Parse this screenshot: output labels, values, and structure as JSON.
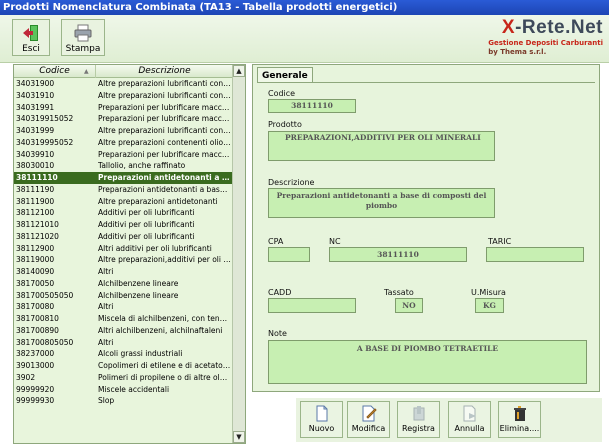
{
  "window": {
    "title": "Prodotti Nomenclatura Combinata (TA13 - Tabella prodotti energetici)"
  },
  "toolbar": {
    "exit_label": "Esci",
    "print_label": "Stampa"
  },
  "brand": {
    "name_x": "X",
    "name_rest": "-Rete.Net",
    "subtitle1": "Gestione Depositi Carburanti",
    "subtitle2": "by Thema s.r.l."
  },
  "list": {
    "columns": {
      "code": "Codice",
      "description": "Descrizione"
    },
    "rows": [
      {
        "code": "34031900",
        "desc": "Altre preparazioni lubrificanti conte..."
      },
      {
        "code": "34031910",
        "desc": "Altre preparazioni lubrificanti conte..."
      },
      {
        "code": "34031991",
        "desc": "Preparazioni per lubrificare macchi..."
      },
      {
        "code": "340319915052",
        "desc": "Preparazioni per lubrificare macchi..."
      },
      {
        "code": "34031999",
        "desc": "Altre preparazioni lubrificanti conte..."
      },
      {
        "code": "340319995052",
        "desc": "Altre preparazioni contenenti olio ri..."
      },
      {
        "code": "34039910",
        "desc": "Preparazioni per lubrificare macchi..."
      },
      {
        "code": "38030010",
        "desc": "Tallolio, anche raffinato"
      },
      {
        "code": "38111110",
        "desc": "Preparazioni antidetonanti a b...",
        "selected": true
      },
      {
        "code": "38111190",
        "desc": "Preparazioni antidetonanti a base..."
      },
      {
        "code": "38111900",
        "desc": "Altre preparazioni antidetonanti"
      },
      {
        "code": "38112100",
        "desc": "Additivi per oli lubrificanti"
      },
      {
        "code": "381121010",
        "desc": "Additivi per oli lubrificanti"
      },
      {
        "code": "381121020",
        "desc": "Additivi per oli lubrificanti"
      },
      {
        "code": "38112900",
        "desc": "Altri additivi per oli lubrificanti"
      },
      {
        "code": "38119000",
        "desc": "Altre preparazioni,additivi per oli m..."
      },
      {
        "code": "38140090",
        "desc": "Altri"
      },
      {
        "code": "38170050",
        "desc": "Alchilbenzene lineare"
      },
      {
        "code": "381700505050",
        "desc": "Alchilbenzene lineare"
      },
      {
        "code": "38170080",
        "desc": "Altri"
      },
      {
        "code": "381700810",
        "desc": "Miscela di alchilbenzeni, con tenore..."
      },
      {
        "code": "381700890",
        "desc": "Altri alchilbenzeni, alchilnaftaleni"
      },
      {
        "code": "381700805050",
        "desc": "Altri"
      },
      {
        "code": "38237000",
        "desc": "Alcoli grassi industriali"
      },
      {
        "code": "39013000",
        "desc": "Copolimeri di etilene e di acetato d..."
      },
      {
        "code": "3902",
        "desc": "Polimeri di propilene o di altre olefi..."
      },
      {
        "code": "99999920",
        "desc": "Miscele accidentali"
      },
      {
        "code": "99999930",
        "desc": "Slop"
      }
    ]
  },
  "detail": {
    "tab": "Generale",
    "codice_label": "Codice",
    "codice": "38111110",
    "prodotto_label": "Prodotto",
    "prodotto": "PREPARAZIONI,ADDITIVI PER OLI MINERALI",
    "descrizione_label": "Descrizione",
    "descrizione": "Preparazioni antidetonanti a base di composti del piombo",
    "cpa_label": "CPA",
    "cpa": "",
    "nc_label": "NC",
    "nc": "38111110",
    "taric_label": "TARIC",
    "taric": "",
    "cadd_label": "CADD",
    "cadd": "",
    "tassato_label": "Tassato",
    "tassato": "NO",
    "umisura_label": "U.Misura",
    "umisura": "KG",
    "note_label": "Note",
    "note": "A BASE DI PIOMBO TETRAETILE"
  },
  "actions": {
    "new": "Nuovo",
    "edit": "Modifica",
    "save": "Registra",
    "cancel": "Annulla",
    "delete": "Elimina...."
  },
  "colors": {
    "accent": "#3a6b1f",
    "field_bg": "#c7efb2",
    "panel_bg": "#e7f4dc",
    "brand_red": "#c7261a"
  }
}
